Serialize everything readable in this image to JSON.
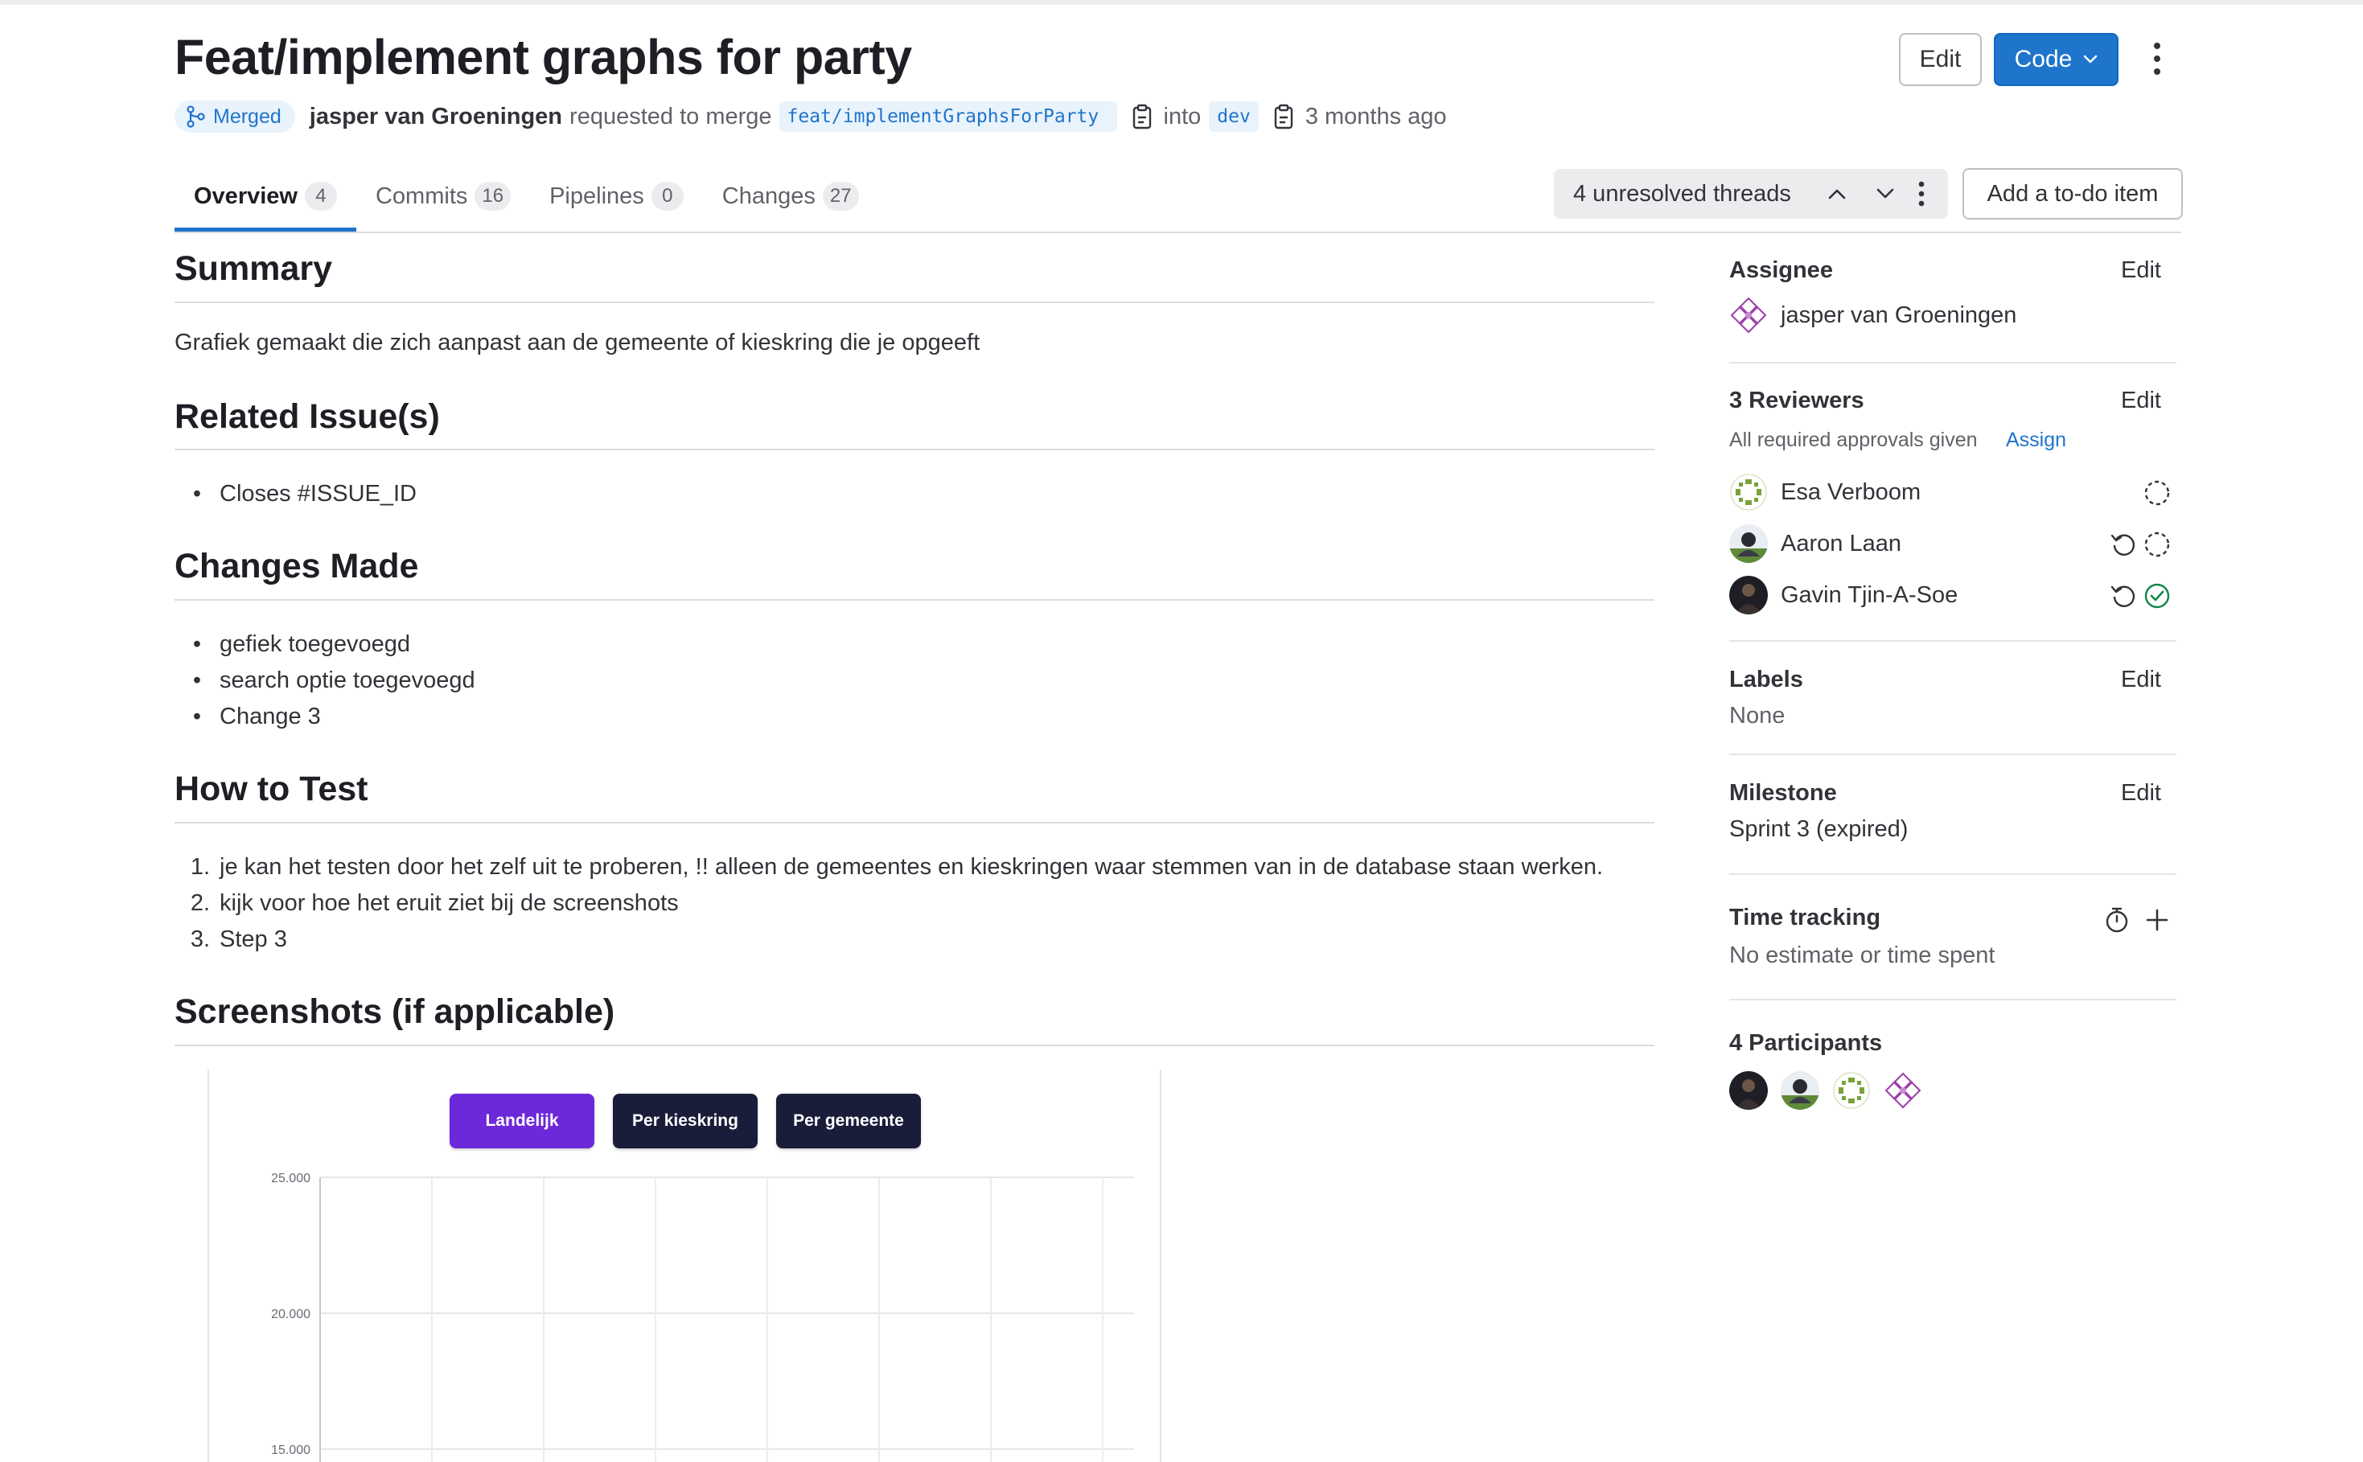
{
  "header": {
    "title": "Feat/implement graphs for party",
    "edit_label": "Edit",
    "code_label": "Code",
    "status_badge": "Merged",
    "author": "jasper van Groeningen",
    "requested_text": "requested to merge",
    "source_branch": "feat/implementGraphsForParty",
    "into_text": "into",
    "target_branch": "dev",
    "time_ago": "3 months ago"
  },
  "tabs": [
    {
      "label": "Overview",
      "count": "4"
    },
    {
      "label": "Commits",
      "count": "16"
    },
    {
      "label": "Pipelines",
      "count": "0"
    },
    {
      "label": "Changes",
      "count": "27"
    }
  ],
  "threads": {
    "label": "4 unresolved threads"
  },
  "todo_label": "Add a to-do item",
  "description": {
    "summary": {
      "heading": "Summary",
      "text": "Grafiek gemaakt die zich aanpast aan de gemeente of kieskring die je opgeeft"
    },
    "related": {
      "heading": "Related Issue(s)",
      "items": [
        "Closes #ISSUE_ID"
      ]
    },
    "changes": {
      "heading": "Changes Made",
      "items": [
        "gefiek toegevoegd",
        "search optie toegevoegd",
        "Change 3"
      ]
    },
    "howto": {
      "heading": "How to Test",
      "items": [
        "je kan het testen door het zelf uit te proberen, !! alleen de gemeentes en kieskringen waar stemmen van in de database staan werken.",
        "kijk voor hoe het eruit ziet bij de screenshots",
        "Step 3"
      ]
    },
    "screenshots": {
      "heading": "Screenshots (if applicable)"
    }
  },
  "embedded_screenshot": {
    "buttons": [
      "Landelijk",
      "Per kieskring",
      "Per gemeente"
    ],
    "colors": {
      "active": "#6d28d9",
      "inactive": "#1a1d3a"
    }
  },
  "chart_data": {
    "type": "line",
    "x": [],
    "series": [],
    "y_ticks": [
      "25.000",
      "20.000",
      "15.000"
    ],
    "ylim": [
      15000,
      25000
    ],
    "grid": true
  },
  "sidebar": {
    "assignee": {
      "label": "Assignee",
      "edit": "Edit",
      "name": "jasper van Groeningen"
    },
    "reviewers": {
      "label": "3 Reviewers",
      "edit": "Edit",
      "approvals_text": "All required approvals given",
      "assign_label": "Assign",
      "list": [
        {
          "name": "Esa Verboom",
          "status": "pending"
        },
        {
          "name": "Aaron Laan",
          "status": "pending"
        },
        {
          "name": "Gavin Tjin-A-Soe",
          "status": "approved"
        }
      ]
    },
    "labels": {
      "label": "Labels",
      "edit": "Edit",
      "value": "None"
    },
    "milestone": {
      "label": "Milestone",
      "edit": "Edit",
      "value": "Sprint 3 (expired)"
    },
    "time_tracking": {
      "label": "Time tracking",
      "value": "No estimate or time spent"
    },
    "participants": {
      "label": "4 Participants",
      "count": 4
    }
  },
  "colors": {
    "accent": "#1f75cb",
    "approved": "#108548",
    "text": "#333238",
    "muted": "#626168"
  }
}
